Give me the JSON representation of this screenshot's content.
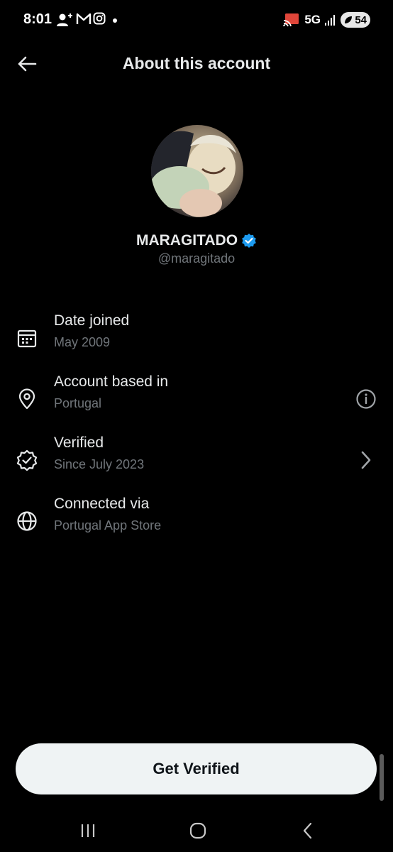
{
  "status_bar": {
    "time": "8:01",
    "network": "5G",
    "battery": "54",
    "icons": [
      "add-contact-icon",
      "gmail-icon",
      "instagram-icon",
      "dot-icon",
      "cast-icon",
      "signal-icon",
      "battery-saver-icon"
    ]
  },
  "header": {
    "title": "About this account",
    "back_icon": "arrow-left-icon"
  },
  "profile": {
    "display_name": "MARAGITADO",
    "handle": "@maragitado",
    "verified_badge_color": "#1d9bf0"
  },
  "info": [
    {
      "icon": "calendar-icon",
      "label": "Date joined",
      "value": "May 2009"
    },
    {
      "icon": "location-pin-icon",
      "label": "Account based in",
      "value": "Portugal",
      "action_icon": "info-circle-icon"
    },
    {
      "icon": "verified-badge-icon",
      "label": "Verified",
      "value": "Since July 2023",
      "action_icon": "chevron-right-icon"
    },
    {
      "icon": "globe-icon",
      "label": "Connected via",
      "value": "Portugal App Store"
    }
  ],
  "cta": {
    "label": "Get Verified"
  },
  "colors": {
    "background": "#000000",
    "primary_text": "#e7e9ea",
    "secondary_text": "#71767b",
    "button_bg": "#eff3f4"
  }
}
